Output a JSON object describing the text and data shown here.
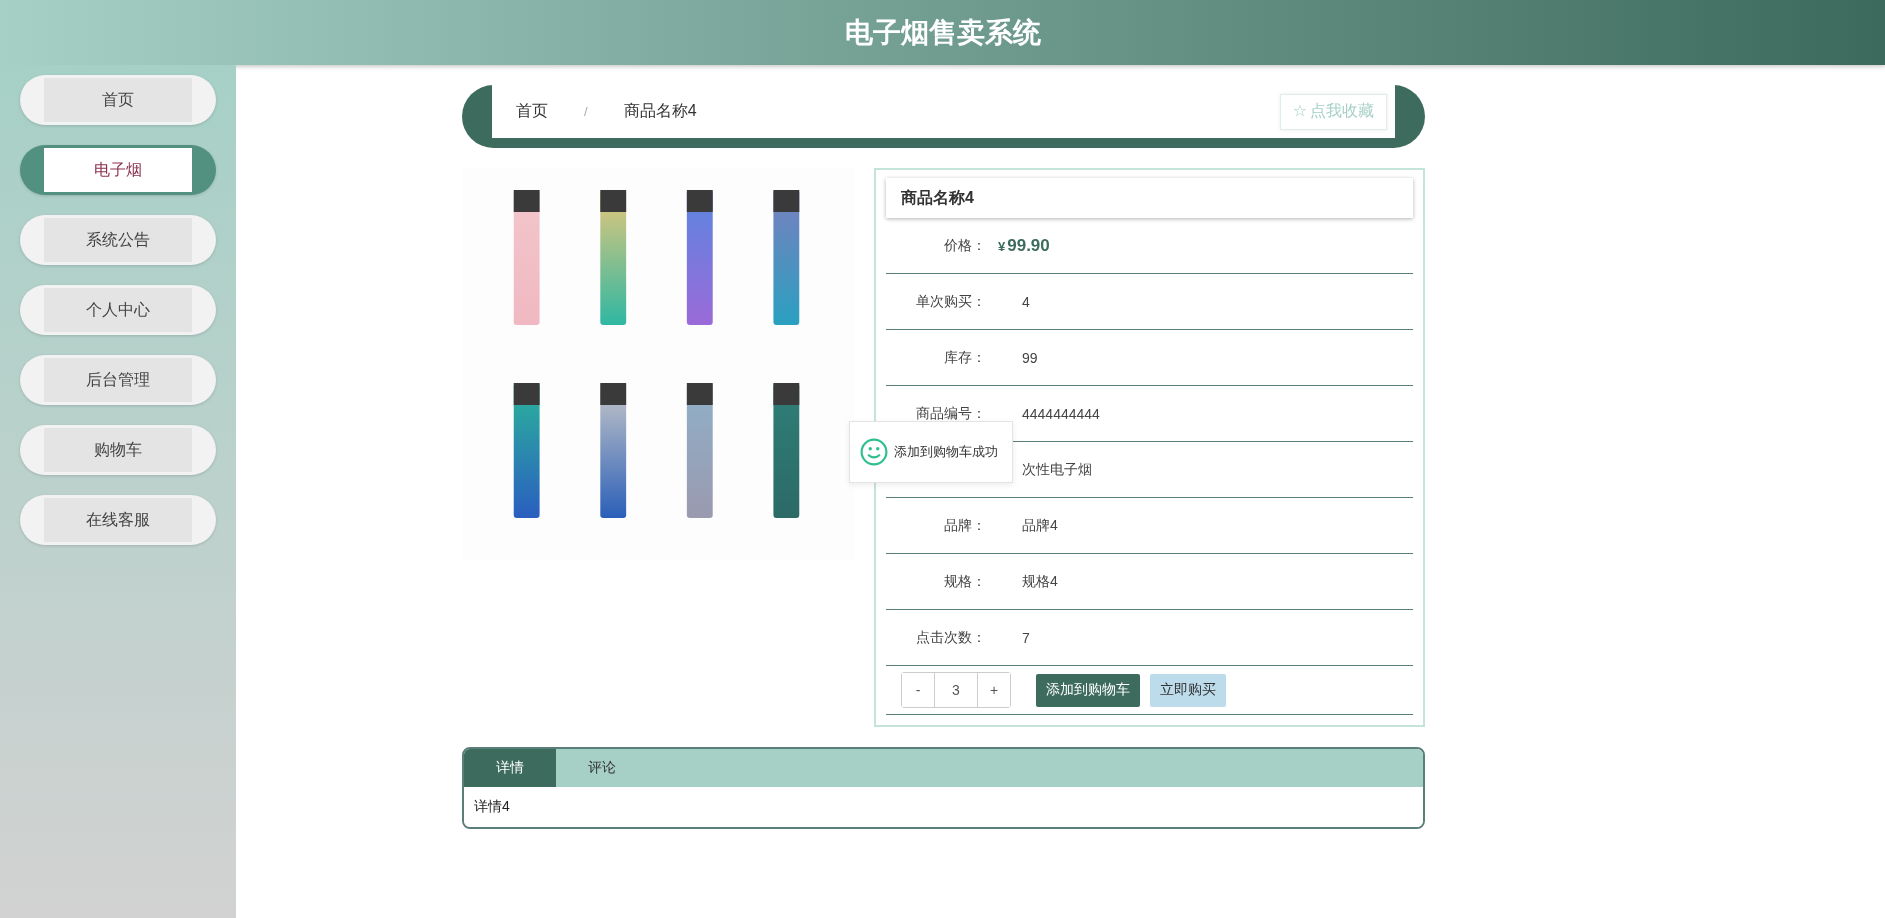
{
  "header": {
    "title": "电子烟售卖系统"
  },
  "sidebar": {
    "items": [
      {
        "label": "首页",
        "selected": false
      },
      {
        "label": "电子烟",
        "selected": true
      },
      {
        "label": "系统公告",
        "selected": false
      },
      {
        "label": "个人中心",
        "selected": false
      },
      {
        "label": "后台管理",
        "selected": false
      },
      {
        "label": "购物车",
        "selected": false
      },
      {
        "label": "在线客服",
        "selected": false
      }
    ]
  },
  "breadcrumb": {
    "items": [
      "首页",
      "商品名称4"
    ],
    "separator": "/",
    "favorite_button": "点我收藏",
    "favorite_icon": "☆"
  },
  "details": {
    "name": "商品名称4",
    "rows": [
      {
        "kind": "price",
        "label": "价格：",
        "currency": "¥",
        "value": "99.90"
      },
      {
        "kind": "text",
        "label": "单次购买：",
        "value": "4"
      },
      {
        "kind": "text",
        "label": "库存：",
        "value": "99"
      },
      {
        "kind": "text",
        "label": "商品编号：",
        "value": "4444444444"
      },
      {
        "kind": "text",
        "value": "次性电子烟"
      },
      {
        "kind": "text",
        "label": "品牌：",
        "value": "品牌4"
      },
      {
        "kind": "text",
        "label": "规格：",
        "value": "规格4"
      },
      {
        "kind": "text",
        "label": "点击次数：",
        "value": "7"
      }
    ],
    "quantity": {
      "minus": "-",
      "value": "3",
      "plus": "+"
    },
    "add_to_cart_button": "添加到购物车",
    "buy_now_button": "立即购买"
  },
  "toast": {
    "message": "添加到购物车成功"
  },
  "tabs": {
    "items": [
      {
        "label": "详情",
        "selected": true
      },
      {
        "label": "评论",
        "selected": false
      }
    ],
    "content": "详情4"
  }
}
